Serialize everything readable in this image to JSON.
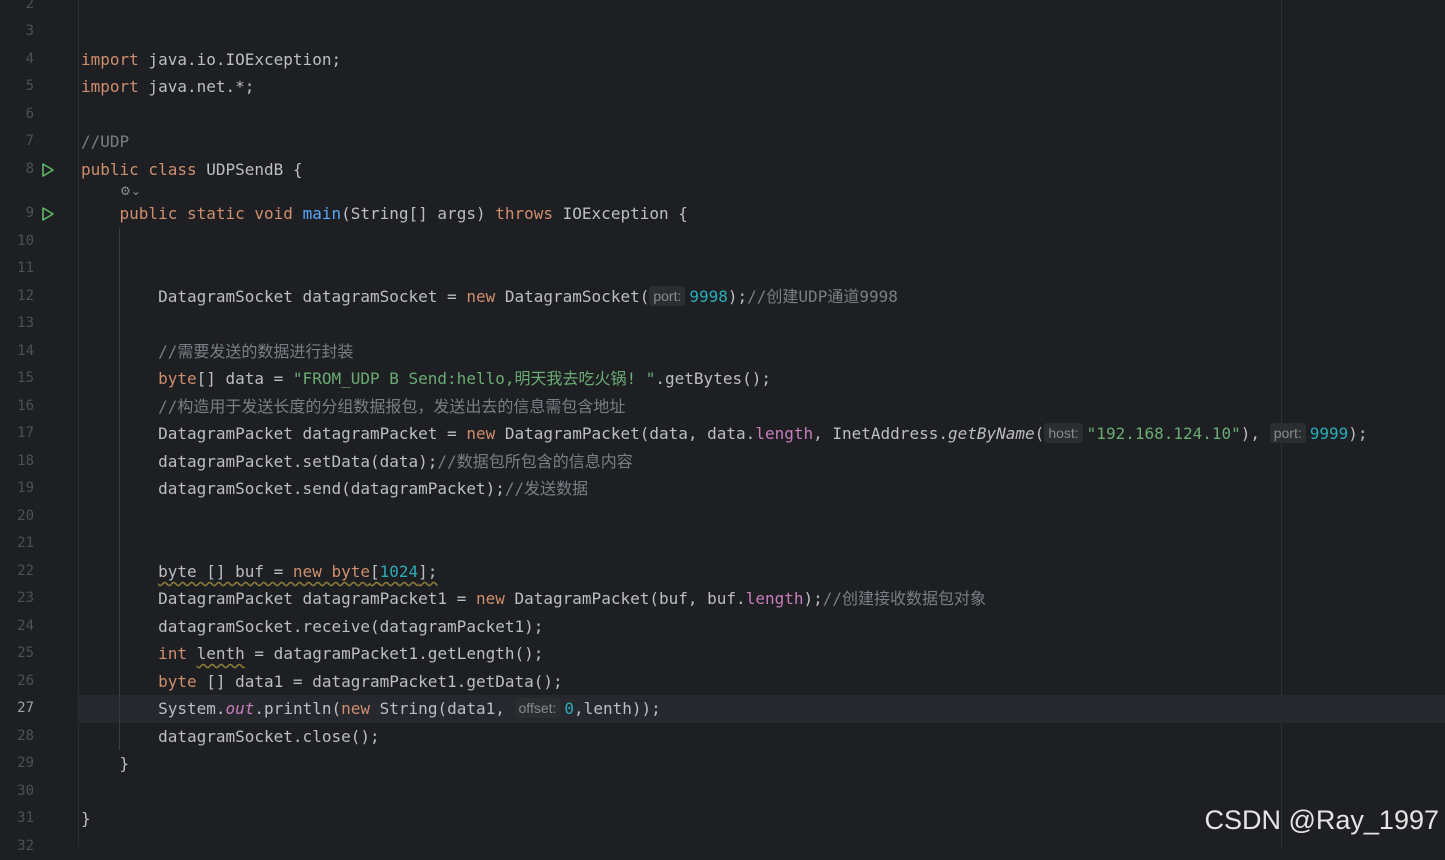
{
  "editor": {
    "active_line": "27",
    "lines": [
      {
        "n": "2"
      },
      {
        "n": "3"
      },
      {
        "n": "4",
        "parts": [
          {
            "t": "import",
            "c": "kw"
          },
          {
            "t": " java.io.IOException;"
          }
        ]
      },
      {
        "n": "5",
        "parts": [
          {
            "t": "import",
            "c": "kw"
          },
          {
            "t": " java.net.*;"
          }
        ]
      },
      {
        "n": "6"
      },
      {
        "n": "7",
        "parts": [
          {
            "t": "//UDP",
            "c": "cmt"
          }
        ]
      },
      {
        "n": "8",
        "run": true,
        "parts": [
          {
            "t": "public class",
            "c": "kw"
          },
          {
            "t": " UDPSendB {"
          }
        ]
      },
      {
        "n": "9",
        "run": true,
        "parts": [
          {
            "t": "    "
          },
          {
            "t": "public static void",
            "c": "kw"
          },
          {
            "t": " "
          },
          {
            "t": "main",
            "c": "fn"
          },
          {
            "t": "(String[] args) "
          },
          {
            "t": "throws",
            "c": "kw"
          },
          {
            "t": " IOException {"
          }
        ]
      },
      {
        "n": "10"
      },
      {
        "n": "11"
      },
      {
        "n": "12",
        "parts": [
          {
            "t": "        DatagramSocket datagramSocket = "
          },
          {
            "t": "new",
            "c": "kw"
          },
          {
            "t": " DatagramSocket("
          },
          {
            "t": "port:",
            "c": "hint"
          },
          {
            "t": "9998",
            "c": "num"
          },
          {
            "t": ");"
          },
          {
            "t": "//创建UDP通道9998",
            "c": "cmt"
          }
        ]
      },
      {
        "n": "13"
      },
      {
        "n": "14",
        "parts": [
          {
            "t": "        "
          },
          {
            "t": "//需要发送的数据进行封装",
            "c": "cmt"
          }
        ]
      },
      {
        "n": "15",
        "parts": [
          {
            "t": "        "
          },
          {
            "t": "byte",
            "c": "kw"
          },
          {
            "t": "[] data = "
          },
          {
            "t": "\"FROM_UDP B Send:hello,明天我去吃火锅! \"",
            "c": "str"
          },
          {
            "t": ".getBytes();"
          }
        ]
      },
      {
        "n": "16",
        "parts": [
          {
            "t": "        "
          },
          {
            "t": "//构造用于发送长度的分组数据报包，发送出去的信息需包含地址",
            "c": "cmt"
          }
        ]
      },
      {
        "n": "17",
        "parts": [
          {
            "t": "        DatagramPacket datagramPacket = "
          },
          {
            "t": "new",
            "c": "kw"
          },
          {
            "t": " DatagramPacket(data, data."
          },
          {
            "t": "length",
            "c": "field"
          },
          {
            "t": ", InetAddress."
          },
          {
            "t": "getByName",
            "c": "ital"
          },
          {
            "t": "("
          },
          {
            "t": "host:",
            "c": "hint"
          },
          {
            "t": "\"192.168.124.10\"",
            "c": "str"
          },
          {
            "t": "), "
          },
          {
            "t": "port:",
            "c": "hint"
          },
          {
            "t": "9999",
            "c": "num"
          },
          {
            "t": ");"
          }
        ]
      },
      {
        "n": "18",
        "parts": [
          {
            "t": "        datagramPacket.setData(data);"
          },
          {
            "t": "//数据包所包含的信息内容",
            "c": "cmt"
          }
        ]
      },
      {
        "n": "19",
        "parts": [
          {
            "t": "        datagramSocket.send(datagramPacket);"
          },
          {
            "t": "//发送数据",
            "c": "cmt"
          }
        ]
      },
      {
        "n": "20"
      },
      {
        "n": "21"
      },
      {
        "n": "22",
        "parts": [
          {
            "t": "        "
          },
          {
            "t": "byte [] buf = ",
            "c": "warn"
          },
          {
            "t": "new byte",
            "c": "kw warn"
          },
          {
            "t": "[",
            "c": "warn"
          },
          {
            "t": "1024",
            "c": "num warn"
          },
          {
            "t": "];",
            "c": "warn"
          }
        ]
      },
      {
        "n": "23",
        "parts": [
          {
            "t": "        DatagramPacket datagramPacket1 = "
          },
          {
            "t": "new",
            "c": "kw"
          },
          {
            "t": " DatagramPacket(buf, buf."
          },
          {
            "t": "length",
            "c": "field"
          },
          {
            "t": ");"
          },
          {
            "t": "//创建接收数据包对象",
            "c": "cmt"
          }
        ]
      },
      {
        "n": "24",
        "parts": [
          {
            "t": "        datagramSocket.receive(datagramPacket1);"
          }
        ]
      },
      {
        "n": "25",
        "parts": [
          {
            "t": "        "
          },
          {
            "t": "int",
            "c": "kw"
          },
          {
            "t": " "
          },
          {
            "t": "lenth",
            "c": "warn"
          },
          {
            "t": " = datagramPacket1.getLength();"
          }
        ]
      },
      {
        "n": "26",
        "parts": [
          {
            "t": "        "
          },
          {
            "t": "byte",
            "c": "kw"
          },
          {
            "t": " [] data1 = datagramPacket1.getData();"
          }
        ]
      },
      {
        "n": "27",
        "parts": [
          {
            "t": "        System."
          },
          {
            "t": "out",
            "c": "field ital"
          },
          {
            "t": ".println("
          },
          {
            "t": "new",
            "c": "kw"
          },
          {
            "t": " String(data1, "
          },
          {
            "t": "offset:",
            "c": "hint"
          },
          {
            "t": "0",
            "c": "num"
          },
          {
            "t": ",lenth));"
          }
        ]
      },
      {
        "n": "28",
        "parts": [
          {
            "t": "        datagramSocket.close();"
          }
        ]
      },
      {
        "n": "29",
        "parts": [
          {
            "t": "    }"
          }
        ]
      },
      {
        "n": "30"
      },
      {
        "n": "31",
        "parts": [
          {
            "t": "}"
          }
        ]
      },
      {
        "n": "32"
      }
    ]
  },
  "icons": {
    "run": "run-gutter-icon",
    "ai": "ai-assistant-icon"
  },
  "watermark": "CSDN @Ray_1997",
  "colors": {
    "background": "#1e1f22",
    "keyword": "#cf8e6d",
    "string": "#6aab73",
    "number": "#2aacb8",
    "comment": "#7a7e85",
    "method": "#56a8f5",
    "field": "#c77dbb",
    "run_icon": "#5fb865"
  }
}
